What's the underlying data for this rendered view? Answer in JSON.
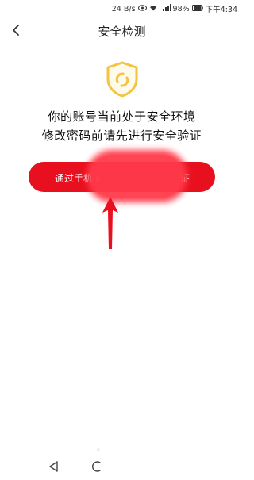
{
  "status_bar": {
    "net_speed": "24 B/s",
    "signal_label": "4G",
    "battery": "98%",
    "time": "下午4:34"
  },
  "nav": {
    "back_icon": "chevron-left-icon",
    "title": "安全检测"
  },
  "shield": {
    "icon": "shield-icon",
    "color": "#f3c344"
  },
  "message": {
    "line1": "你的账号当前处于安全环境",
    "line2": "修改密码前请先进行安全验证"
  },
  "verify_button": {
    "label_left": "通过手机+",
    "label_right": "证",
    "color": "#e8101f"
  },
  "annotation": {
    "arrow_color": "#e8101f",
    "redaction_color": "#ff3a4a"
  },
  "system_nav": {
    "back_icon": "triangle-back-icon",
    "home_icon": "home-icon"
  }
}
